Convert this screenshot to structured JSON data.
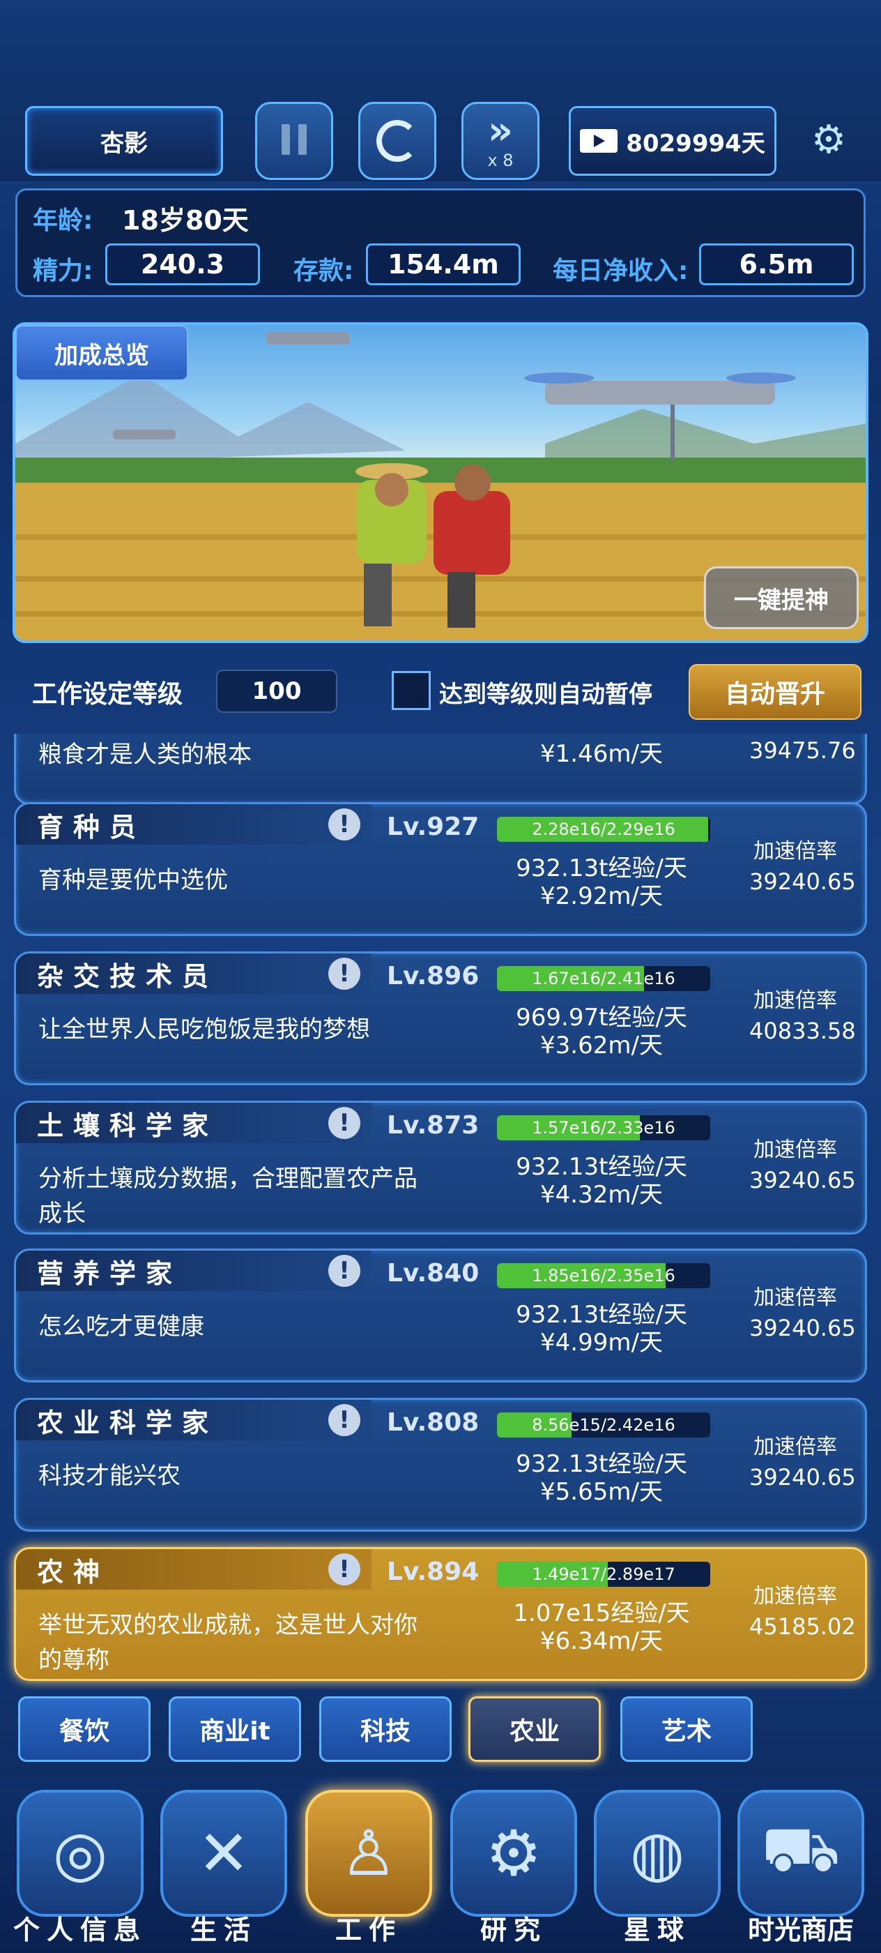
{
  "header": {
    "name": "杏影",
    "speed_label": "x 8",
    "days": "8029994天"
  },
  "stats": {
    "age_label": "年龄:",
    "age_value": "18岁80天",
    "energy_label": "精力:",
    "energy_value": "240.3",
    "savings_label": "存款:",
    "savings_value": "154.4m",
    "income_label": "每日净收入:",
    "income_value": "6.5m"
  },
  "banner": {
    "bonus_label": "加成总览",
    "boost_label": "一键提神"
  },
  "settings": {
    "level_label": "工作设定等级",
    "level_value": "100",
    "auto_pause_label": "达到等级则自动暂停",
    "auto_promote_label": "自动晋升"
  },
  "partial_card": {
    "desc": "粮食才是人类的根本",
    "money": "¥1.46m/天",
    "rate": "39475.76"
  },
  "jobs": [
    {
      "title": "育种员",
      "level": "Lv.927",
      "progress": "2.28e16/2.29e16",
      "progress_fraction": 0.99,
      "desc": "育种是要优中选优",
      "exp": "932.13t经验/天",
      "money": "¥2.92m/天",
      "rate_label": "加速倍率",
      "rate": "39240.65"
    },
    {
      "title": "杂交技术员",
      "level": "Lv.896",
      "progress": "1.67e16/2.41e16",
      "progress_fraction": 0.69,
      "desc": "让全世界人民吃饱饭是我的梦想",
      "exp": "969.97t经验/天",
      "money": "¥3.62m/天",
      "rate_label": "加速倍率",
      "rate": "40833.58"
    },
    {
      "title": "土壤科学家",
      "level": "Lv.873",
      "progress": "1.57e16/2.33e16",
      "progress_fraction": 0.67,
      "desc": "分析土壤成分数据，合理配置农产品成长",
      "exp": "932.13t经验/天",
      "money": "¥4.32m/天",
      "rate_label": "加速倍率",
      "rate": "39240.65"
    },
    {
      "title": "营养学家",
      "level": "Lv.840",
      "progress": "1.85e16/2.35e16",
      "progress_fraction": 0.79,
      "desc": "怎么吃才更健康",
      "exp": "932.13t经验/天",
      "money": "¥4.99m/天",
      "rate_label": "加速倍率",
      "rate": "39240.65"
    },
    {
      "title": "农业科学家",
      "level": "Lv.808",
      "progress": "8.56e15/2.42e16",
      "progress_fraction": 0.35,
      "desc": "科技才能兴农",
      "exp": "932.13t经验/天",
      "money": "¥5.65m/天",
      "rate_label": "加速倍率",
      "rate": "39240.65"
    },
    {
      "title": "农神",
      "level": "Lv.894",
      "progress": "1.49e17/2.89e17",
      "progress_fraction": 0.52,
      "desc": "举世无双的农业成就，这是世人对你的尊称",
      "exp": "1.07e15经验/天",
      "money": "¥6.34m/天",
      "rate_label": "加速倍率",
      "rate": "45185.02"
    }
  ],
  "categories": [
    "餐饮",
    "商业it",
    "科技",
    "农业",
    "艺术"
  ],
  "nav": [
    "个人信息",
    "生活",
    "工作",
    "研究",
    "星球",
    "时光商店"
  ],
  "colors": {
    "accent": "#5fb8ff",
    "gold": "#d7a23b",
    "progress": "#4fc23a"
  }
}
